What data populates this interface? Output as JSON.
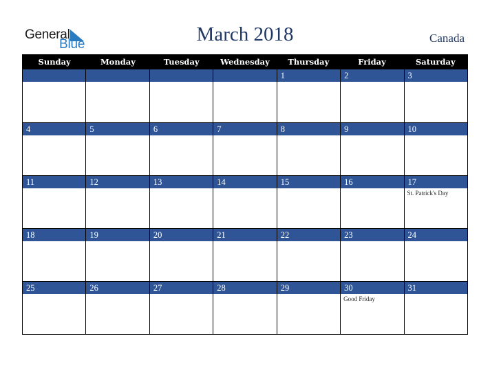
{
  "logo": {
    "line1": "General",
    "line2": "Blue"
  },
  "title": "March 2018",
  "country": "Canada",
  "colors": {
    "header_bg": "#000000",
    "day_bar": "#2f5597",
    "title": "#203864",
    "logo_blue": "#2a7bc0"
  },
  "weekdays": [
    "Sunday",
    "Monday",
    "Tuesday",
    "Wednesday",
    "Thursday",
    "Friday",
    "Saturday"
  ],
  "weeks": [
    [
      {
        "day": "",
        "event": ""
      },
      {
        "day": "",
        "event": ""
      },
      {
        "day": "",
        "event": ""
      },
      {
        "day": "",
        "event": ""
      },
      {
        "day": "1",
        "event": ""
      },
      {
        "day": "2",
        "event": ""
      },
      {
        "day": "3",
        "event": ""
      }
    ],
    [
      {
        "day": "4",
        "event": ""
      },
      {
        "day": "5",
        "event": ""
      },
      {
        "day": "6",
        "event": ""
      },
      {
        "day": "7",
        "event": ""
      },
      {
        "day": "8",
        "event": ""
      },
      {
        "day": "9",
        "event": ""
      },
      {
        "day": "10",
        "event": ""
      }
    ],
    [
      {
        "day": "11",
        "event": ""
      },
      {
        "day": "12",
        "event": ""
      },
      {
        "day": "13",
        "event": ""
      },
      {
        "day": "14",
        "event": ""
      },
      {
        "day": "15",
        "event": ""
      },
      {
        "day": "16",
        "event": ""
      },
      {
        "day": "17",
        "event": "St. Patrick's Day"
      }
    ],
    [
      {
        "day": "18",
        "event": ""
      },
      {
        "day": "19",
        "event": ""
      },
      {
        "day": "20",
        "event": ""
      },
      {
        "day": "21",
        "event": ""
      },
      {
        "day": "22",
        "event": ""
      },
      {
        "day": "23",
        "event": ""
      },
      {
        "day": "24",
        "event": ""
      }
    ],
    [
      {
        "day": "25",
        "event": ""
      },
      {
        "day": "26",
        "event": ""
      },
      {
        "day": "27",
        "event": ""
      },
      {
        "day": "28",
        "event": ""
      },
      {
        "day": "29",
        "event": ""
      },
      {
        "day": "30",
        "event": "Good Friday"
      },
      {
        "day": "31",
        "event": ""
      }
    ]
  ]
}
